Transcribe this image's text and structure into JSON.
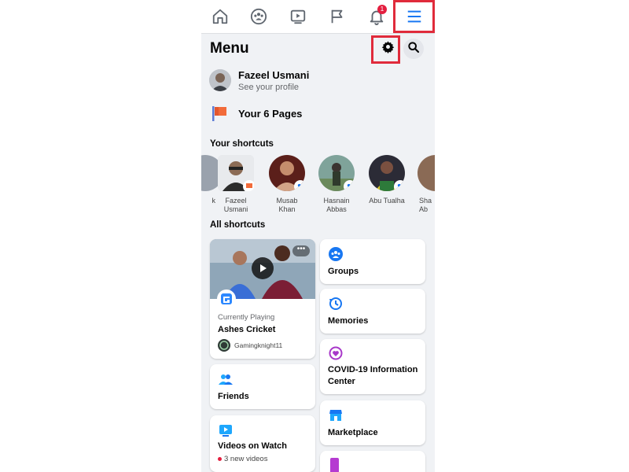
{
  "top_nav": {
    "items": [
      {
        "icon": "home-icon"
      },
      {
        "icon": "groups-icon"
      },
      {
        "icon": "watch-icon"
      },
      {
        "icon": "pages-flag-icon"
      },
      {
        "icon": "notifications-bell-icon",
        "badge": "1"
      },
      {
        "icon": "hamburger-menu-icon",
        "active": true
      }
    ]
  },
  "header": {
    "title": "Menu",
    "settings_icon": "gear-icon",
    "search_icon": "search-icon"
  },
  "profile": {
    "name": "Fazeel Usmani",
    "subtitle": "See your profile"
  },
  "pages": {
    "label": "Your 6 Pages"
  },
  "shortcuts": {
    "title": "Your shortcuts",
    "items": [
      {
        "label": "k"
      },
      {
        "label": "Fazeel\nUsmani"
      },
      {
        "label": "Musab Khan"
      },
      {
        "label": "Hasnain\nAbbas"
      },
      {
        "label": "Abu Tualha"
      },
      {
        "label": "Sha\nAb"
      }
    ]
  },
  "all_shortcuts": {
    "title": "All shortcuts",
    "gaming": {
      "status": "Currently Playing",
      "game": "Ashes Cricket",
      "player": "Gamingknight11"
    },
    "friends": {
      "label": "Friends"
    },
    "videos": {
      "label": "Videos on Watch",
      "sub": "3 new videos"
    },
    "groups": {
      "label": "Groups"
    },
    "memories": {
      "label": "Memories"
    },
    "covid": {
      "label": "COVID-19 Information Center"
    },
    "marketplace": {
      "label": "Marketplace"
    }
  },
  "colors": {
    "accent": "#1877f2",
    "highlight": "#e02b3b",
    "notify": "#e41e3f"
  }
}
